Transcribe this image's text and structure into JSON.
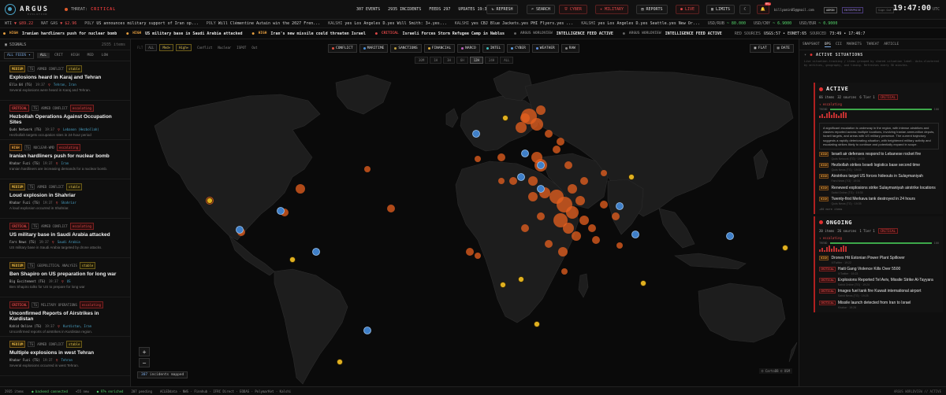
{
  "app": {
    "name": "ARGUS",
    "subtitle": "EVOLUTION"
  },
  "threat": {
    "label": "THREAT:",
    "level": "CRITICAL"
  },
  "stats": {
    "events": "307 EVENTS",
    "incidents": "2935 INCIDENTS",
    "feeds": "FEEDS 297",
    "updates": "UPDATES 19:30"
  },
  "toolbar": {
    "refresh": "REFRESH",
    "search": "SEARCH",
    "cyber": "CYBER",
    "military": "MILITARY",
    "reports": "REPORTS",
    "live": "LIVE",
    "limits": "LIMITS",
    "notif_count": "99+",
    "user": "billyamin05@gmail.com",
    "admin": "ADMIN",
    "enterprise": "ENTERPRISE",
    "signout": "Sign Out"
  },
  "clock": {
    "time": "19:47:00",
    "tz": "UTC"
  },
  "ticker1": [
    {
      "label": "WTI",
      "value": "▼ $89.22",
      "tone": "r"
    },
    {
      "label": "NAT GAS",
      "value": "▼ $2.96",
      "tone": "r"
    },
    {
      "label": "POLY",
      "value": "US announces military support of Iran op...",
      "tone": "w"
    },
    {
      "label": "POLY",
      "value": "Will Clémentine Autain win the 2027 Fren...",
      "tone": "w"
    },
    {
      "label": "KALSHI",
      "value": "yes Los Angeles D.yes Will Smith: 3+.yes...",
      "tone": "w"
    },
    {
      "label": "KALSHI",
      "value": "yes CBJ Blue Jackets.yes PHI Flyers.yes ...",
      "tone": "w"
    },
    {
      "label": "KALSHI",
      "value": "yes Los Angeles D.yes Seattle.yes New Or...",
      "tone": "w"
    },
    {
      "label": "USD/RUB",
      "value": "~ 80.000",
      "tone": "g"
    },
    {
      "label": "USD/CNY",
      "value": "~ 6.9000",
      "tone": "g"
    },
    {
      "label": "USD/EUR",
      "value": "~ 0.9000",
      "tone": "g"
    }
  ],
  "ticker2": [
    {
      "sev": "HIGH",
      "title": "Iranian hardliners push for nuclear bomb"
    },
    {
      "sev": "HIGH",
      "title": "US military base in Saudi Arabia attacked"
    },
    {
      "sev": "HIGH",
      "title": "Iran's new missile could threaten Israel"
    },
    {
      "sev": "CRITICAL",
      "title": "Israeli Forces Storm Refugee Camp in Nablus"
    },
    {
      "sev": "ARGUS WORLDVIEW",
      "title": "INTELLIGENCE FEED ACTIVE"
    },
    {
      "sev": "ARGUS WORLDVIEW",
      "title": "INTELLIGENCE FEED ACTIVE"
    }
  ],
  "ticker2_right": {
    "sources": "RED SOURCES",
    "usdsy": "USGS:57 • EONET:65",
    "sourced": "SOURCED",
    "time": "73:49 • 17:46:7"
  },
  "left": {
    "header": "SIGNALS",
    "count": "2935 items",
    "feed_select": "ALL FEEDS ▾",
    "filters": [
      "ALL",
      "CRIT",
      "HIGH",
      "MED",
      "LOW"
    ],
    "signals": [
      {
        "sev": "MEDIUM",
        "tg": "TG",
        "cat": "ARMED CONFLICT",
        "state": "stable",
        "state_type": "stable",
        "title": "Explosions heard in Karaj and Tehran",
        "src": "Ella 04 (TG)",
        "time": "19:37",
        "loc": "Tehran, Iran",
        "desc": "Several explosions were heard in Karaj and Tehran."
      },
      {
        "sev": "CRITICAL",
        "tg": "TG",
        "cat": "ARMED CONFLICT",
        "state": "escalating",
        "state_type": "esc",
        "title": "Hezbollah Operations Against Occupation Sites",
        "src": "Quds Network (TG)",
        "time": "19:37",
        "loc": "Lebanon (Hezbollah)",
        "desc": "Hezbollah targets occupation sites in 24-hour period"
      },
      {
        "sev": "HIGH",
        "tg": "TG",
        "cat": "NUCLEAR-WMD",
        "state": "escalating",
        "state_type": "esc",
        "title": "Iranian hardliners push for nuclear bomb",
        "src": "Khabar Fuzi (TG)",
        "time": "19:37",
        "loc": "Iran",
        "desc": "Iranian hardliners are increasing demands for a nuclear bomb."
      },
      {
        "sev": "MEDIUM",
        "tg": "TG",
        "cat": "ARMED CONFLICT",
        "state": "stable",
        "state_type": "stable",
        "title": "Loud explosion in Shahriar",
        "src": "Khabar Fuzi (TG)",
        "time": "19:37",
        "loc": "Shahriar",
        "desc": "A loud explosion occurred in Shahriar."
      },
      {
        "sev": "CRITICAL",
        "tg": "TG",
        "cat": "ARMED CONFLICT",
        "state": "escalating",
        "state_type": "esc",
        "title": "US military base in Saudi Arabia attacked",
        "src": "Fars News (TG)",
        "time": "19:37",
        "loc": "Saudi Arabia",
        "desc": "US military base in Saudi Arabia targeted by drone attacks."
      },
      {
        "sev": "MEDIUM",
        "tg": "TG",
        "cat": "GEOPOLITICAL ANALYSIS",
        "state": "stable",
        "state_type": "stable",
        "title": "Ben Shapiro on US preparation for long war",
        "src": "Big Excitement (TG)",
        "time": "19:37",
        "loc": "US",
        "desc": "Ben Shapiro talks for US to prepare for long war"
      },
      {
        "sev": "CRITICAL",
        "tg": "TG",
        "cat": "MILITARY OPERATIONS",
        "state": "escalating",
        "state_type": "esc",
        "title": "Unconfirmed Reports of Airstrikes in Kurdistan",
        "src": "Kahid Online (TG)",
        "time": "19:37",
        "loc": "Kurdistan, Iran",
        "desc": "Unconfirmed reports of airstrikes in Kurdistan region."
      },
      {
        "sev": "MEDIUM",
        "tg": "TG",
        "cat": "ARMED CONFLICT",
        "state": "stable",
        "state_type": "stable",
        "title": "Multiple explosions in west Tehran",
        "src": "Khabar Fuzi (TG)",
        "time": "19:37",
        "loc": "Tehran",
        "desc": "Several explosions occurred in west Tehran."
      }
    ]
  },
  "map": {
    "mode_buttons": [
      "ALL",
      "Med+",
      "High+"
    ],
    "mode_extra": [
      "Conflict",
      "Nuclear",
      "ISPOT",
      "Out"
    ],
    "layers": [
      {
        "label": "CONFLICT",
        "color": "#e05040"
      },
      {
        "label": "MARITIME",
        "color": "#4a90d9"
      },
      {
        "label": "SANCTIONS",
        "color": "#c0a040"
      },
      {
        "label": "FINANCIAL",
        "color": "#e0b040"
      },
      {
        "label": "NARCO",
        "color": "#c060c0"
      },
      {
        "label": "INTEL",
        "color": "#40c0c0"
      },
      {
        "label": "CYBER",
        "color": "#60a0e0"
      },
      {
        "label": "WEATHER",
        "color": "#6090e0"
      },
      {
        "label": "RAW",
        "color": "#888888"
      }
    ],
    "time_buttons": [
      "30M",
      "1H",
      "3H",
      "6H",
      "12H",
      "24H",
      "ALL"
    ],
    "time_active": "12H",
    "view_flat": "FLAT",
    "view_date": "DATE",
    "zoom_in": "+",
    "zoom_out": "−",
    "mapped_count": "307",
    "mapped_label": "incidents mapped",
    "attribution": "© CartoDB © OSM"
  },
  "right": {
    "tabs": [
      "SNAPSHOT",
      "OPS",
      "CII",
      "MARKETS",
      "THREAT",
      "ARTICLE"
    ],
    "tab_active": "OPS",
    "title": "ACTIVE SITUATIONS",
    "subtitle": "Live situation-tracking / items grouped by shared situation label. Auto-clustered by entities, geography, and timing. Refreshes every 30 minutes.",
    "groups": [
      {
        "name": "ACTIVE",
        "items_count": "66 items",
        "sources": "32 sources",
        "tier": "6 Tier 1",
        "severity": "CRITICAL",
        "escalating": "↑ escalating",
        "bar_left": "TREND",
        "bar_right": "100",
        "summary": "A significant escalation is underway in the region, with intense airstrikes and clashes reported across multiple locations, involving Iranian ammunition depots, Israeli targets, and areas with US military presence. The current trajectory suggests a rapidly deteriorating situation, with heightened military activity and escalating strikes likely to continue and potentially expand in scope.",
        "items": [
          {
            "sev": "HIGH",
            "title": "Israeli air defenses respond to Lebanese rocket fire",
            "src": "Quds Network (TG) · 19:30"
          },
          {
            "sev": "HIGH",
            "title": "Hezbollah strikes Israeli logistics base second time",
            "src": "Quds News (TG) · 19:33"
          },
          {
            "sev": "HIGH",
            "title": "Airstrikes target US forces hideouts in Sulaymaniyah",
            "src": "Fars News (TG) · 19:34"
          },
          {
            "sev": "HIGH",
            "title": "Renewed explosions strike Sulaymaniyah airstrike locations",
            "src": "Sahid Online (TG) · 19:35"
          },
          {
            "sev": "HIGH",
            "title": "Twenty-first Merkava tank destroyed in 24 hours",
            "src": "Quds News (TG) · 19:35"
          }
        ],
        "more": "+60 more items"
      },
      {
        "name": "ONGOING",
        "items_count": "20 items",
        "sources": "26 sources",
        "tier": "1 Tier 1",
        "severity": "CRITICAL",
        "escalating": "↑ escalating",
        "bar_left": "TREND",
        "bar_right": "100",
        "summary": "",
        "items": [
          {
            "sev": "HIGH",
            "title": "Drones Hit Estonian Power Plant Spillover",
            "src": "X/Twitter · 19:22"
          },
          {
            "sev": "CRITICAL",
            "title": "Haiti Gang Violence Kills Over 5500",
            "src": "X/Twitter · 19:23"
          },
          {
            "sev": "CRITICAL",
            "title": "Explosions Reported Tel Aviv, Missile Strike Al-Tayyara",
            "src": "Sahid Online (TG) · 19:24"
          },
          {
            "sev": "CRITICAL",
            "title": "Images fuel tank fire Kuwait international airport",
            "src": "Sahid News (TG) · 19:25"
          },
          {
            "sev": "CRITICAL",
            "title": "Missile launch detected from Iran to Israel",
            "src": "Khabar · 19:26"
          }
        ],
        "more": ""
      }
    ]
  },
  "footer": {
    "items": "2935 items",
    "backend": "backend connected",
    "feeds": "+55 new",
    "enriched": "97% enriched",
    "pending": "207 pending",
    "sources": "ACLEDdata · NWS · Finnhub · IFRC Direct · EODAS · PolymarKet · Kalshi",
    "right": "ARGUS WORLDVIEW // ACTIVE"
  }
}
